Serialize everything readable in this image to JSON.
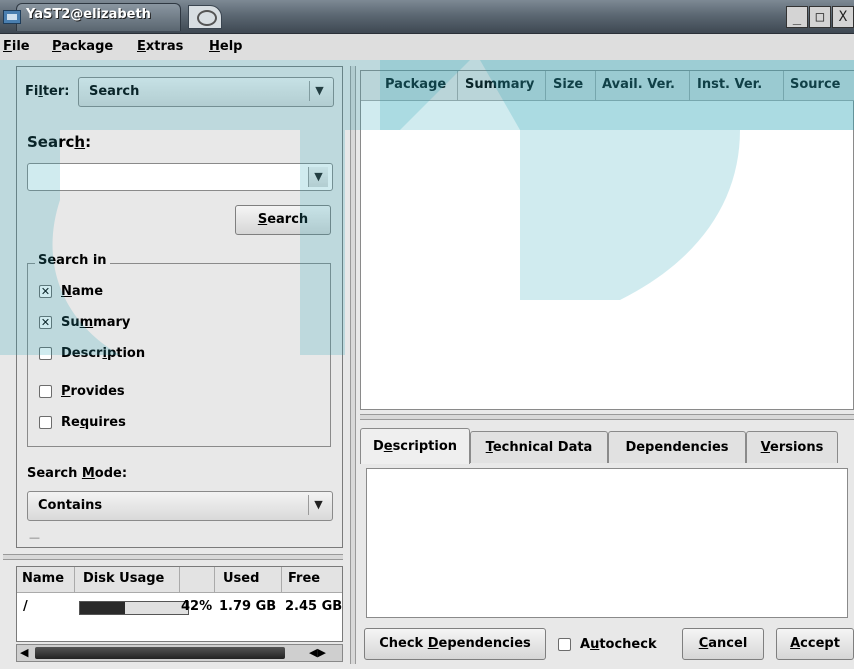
{
  "window": {
    "title": "YaST2@elizabeth",
    "controls": [
      "_",
      "□",
      "X"
    ]
  },
  "menu": {
    "file": "File",
    "package": "Package",
    "extras": "Extras",
    "help": "Help"
  },
  "left_panel": {
    "filter_label": "Filter:",
    "filter_value": "Search",
    "search_label": "Search:",
    "search_input_value": "",
    "search_button": "Search",
    "search_in_title": "Search in",
    "search_in_options": [
      {
        "label": "Name",
        "checked": true
      },
      {
        "label": "Summary",
        "checked": true
      },
      {
        "label": "Description",
        "checked": false
      },
      {
        "label": "Provides",
        "checked": false
      },
      {
        "label": "Requires",
        "checked": false
      }
    ],
    "search_mode_label": "Search Mode:",
    "search_mode_value": "Contains"
  },
  "disk_usage": {
    "headers": [
      "Name",
      "Disk Usage",
      "Used",
      "Free"
    ],
    "rows": [
      {
        "name": "/",
        "percent_text": "42%",
        "percent": 42,
        "used": "1.79 GB",
        "free": "2.45 GB"
      }
    ]
  },
  "package_table": {
    "headers": [
      "Package",
      "Summary",
      "Size",
      "Avail. Ver.",
      "Inst. Ver.",
      "Source"
    ],
    "rows": []
  },
  "detail_tabs": {
    "tabs": [
      "Description",
      "Technical Data",
      "Dependencies",
      "Versions"
    ],
    "active": "Description",
    "content": ""
  },
  "bottom_bar": {
    "check_deps": "Check Dependencies",
    "autocheck": "Autocheck",
    "autocheck_checked": false,
    "cancel": "Cancel",
    "accept": "Accept"
  },
  "colors": {
    "watermark": "#27a3b8",
    "titlebar_dark": "#3e4852"
  }
}
